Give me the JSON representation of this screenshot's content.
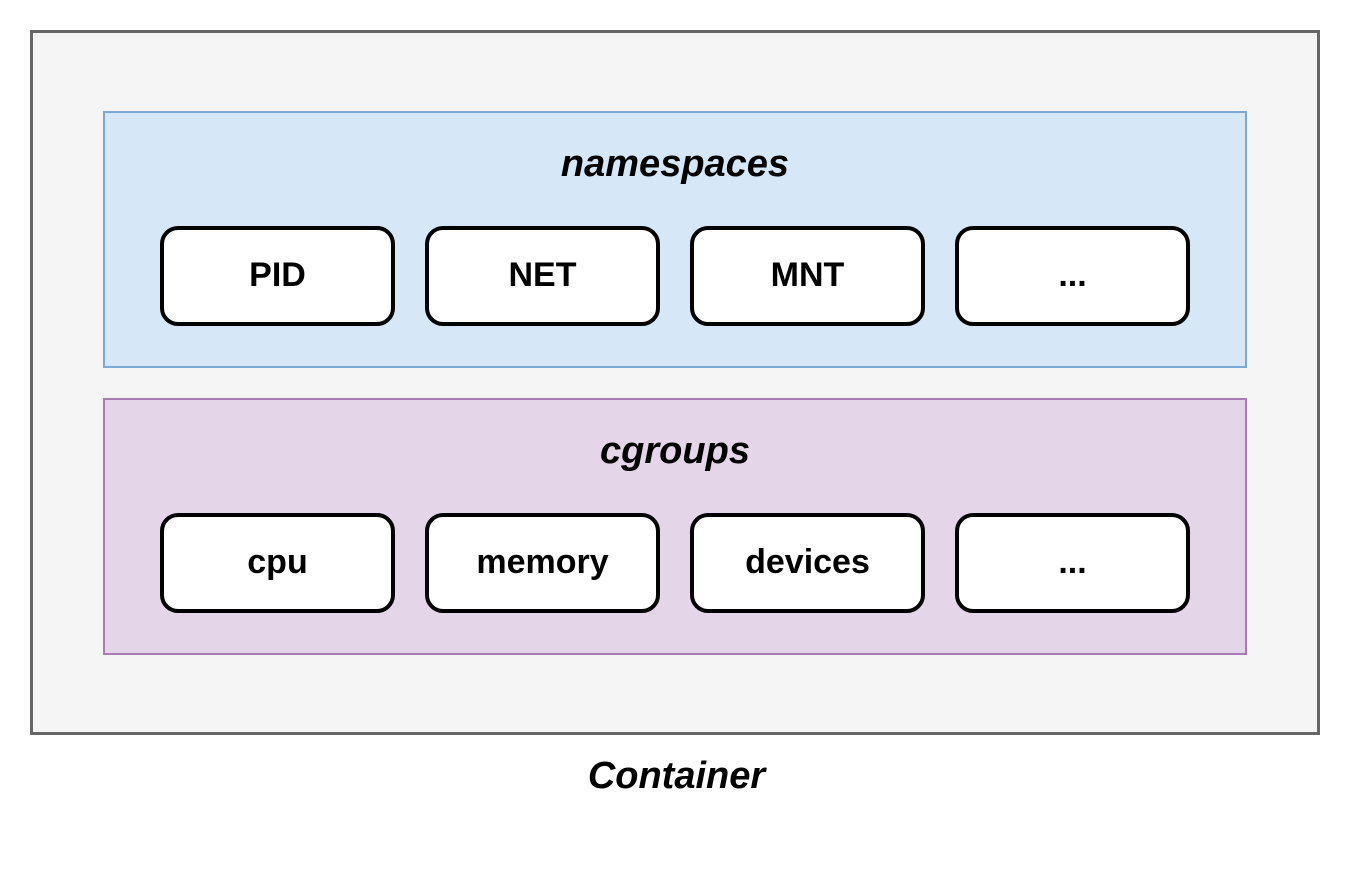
{
  "container": {
    "title": "Container",
    "sections": [
      {
        "key": "namespaces",
        "title": "namespaces",
        "items": [
          "PID",
          "NET",
          "MNT",
          "..."
        ]
      },
      {
        "key": "cgroups",
        "title": "cgroups",
        "items": [
          "cpu",
          "memory",
          "devices",
          "..."
        ]
      }
    ]
  }
}
